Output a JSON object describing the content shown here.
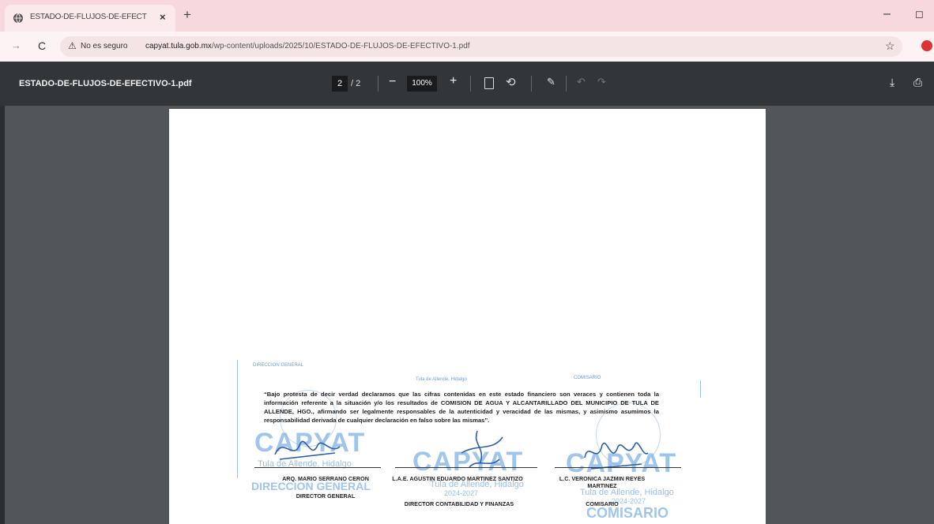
{
  "browser": {
    "tab_title": "ESTADO-DE-FLUJOS-DE-EFECT",
    "tab_close": "×",
    "new_tab": "+",
    "minimize": "–",
    "maximize": "◻",
    "security_label": "No es seguro",
    "url_host": "capyat.tula.gob.mx",
    "url_path": "/wp-content/uploads/2025/10/ESTADO-DE-FLUJOS-DE-EFECTIVO-1.pdf"
  },
  "pdf_viewer": {
    "file_name": "ESTADO-DE-FLUJOS-DE-EFECTIVO-1.pdf",
    "current_page": "2",
    "total_pages": "/ 2",
    "zoom": "100%",
    "zoom_out": "−",
    "zoom_in": "+"
  },
  "document": {
    "declaration": "“Bajo protesta de decir verdad declaramos que las cifras contenidas en este estado financiero son veraces y contienen toda la información referente a la situación y/o los resultados de COMISION DE AGUA Y ALCANTARILLADO DEL MUNICIPIO DE TULA DE ALLENDE, HGO., afirmando ser legalmente responsables de la autenticidad y veracidad de las mismas, y asimismo asumimos la responsabilidad derivada de cualquier declaración en falso sobre las mismas”.",
    "signatories": [
      {
        "name": "ARQ. MARIO SERRANO CERON",
        "role": "DIRECTOR GENERAL"
      },
      {
        "name": "L.A.E. AGUSTIN EDUARDO MARTINEZ SANTIZO",
        "role": "DIRECTOR CONTABILIDAD Y FINANZAS"
      },
      {
        "name": "L.C. VERONICA JAZMIN REYES MARTINEZ",
        "role": "COMISARIO"
      }
    ],
    "stamps": {
      "capyat": "CAPYAT",
      "place": "Tula de Allende, Hidalgo",
      "years": "2024-2027",
      "direccion": "DIRECCION GENERAL",
      "comisario": "COMISARIO"
    }
  },
  "icons": [
    "globe-icon",
    "back-icon",
    "reload-icon",
    "warning-icon",
    "star-icon",
    "profile-icon",
    "fit-page-icon",
    "rotate-icon",
    "annotate-icon",
    "undo-icon",
    "redo-icon",
    "download-icon",
    "print-icon"
  ]
}
